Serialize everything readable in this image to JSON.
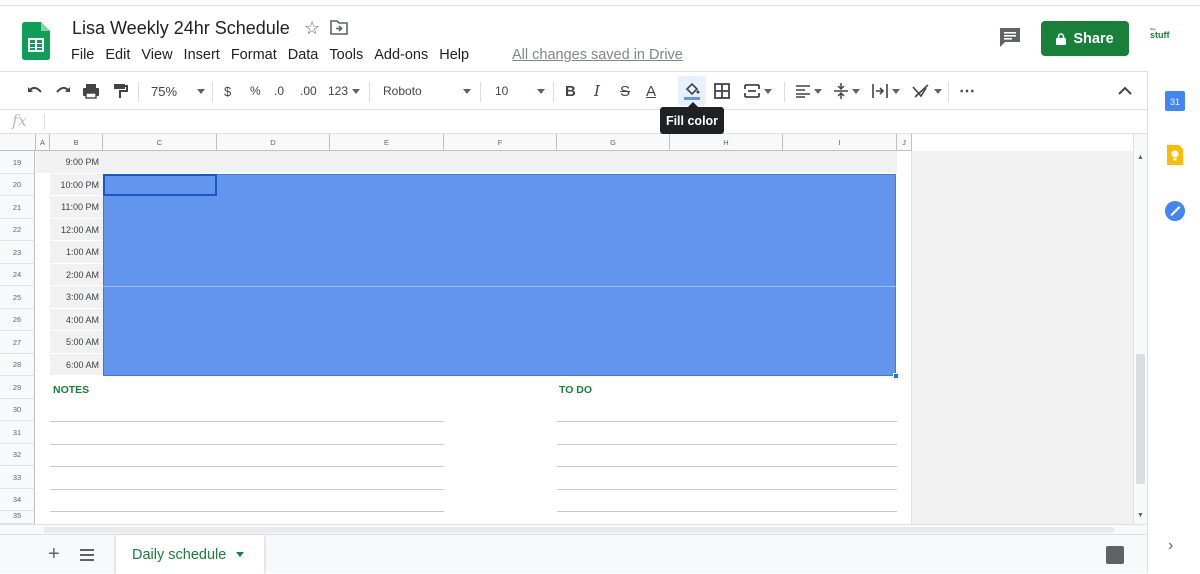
{
  "document": {
    "title": "Lisa Weekly 24hr Schedule",
    "save_status": "All changes saved in Drive"
  },
  "menu": [
    "File",
    "Edit",
    "View",
    "Insert",
    "Format",
    "Data",
    "Tools",
    "Add-ons",
    "Help"
  ],
  "header": {
    "share_label": "Share",
    "brand_text": "stuff"
  },
  "toolbar": {
    "zoom": "75%",
    "currency": "$",
    "percent": "%",
    "decrease_decimal": ".0",
    "increase_decimal": ".00",
    "more_formats": "123",
    "font": "Roboto",
    "font_size": "10",
    "bold": "B",
    "italic": "I",
    "strikethrough": "S",
    "text_color": "A",
    "more": "⋯",
    "tooltip": "Fill color"
  },
  "formula_bar": {
    "fx": "fx",
    "value": ""
  },
  "columns": [
    "A",
    "B",
    "C",
    "D",
    "E",
    "F",
    "G",
    "H",
    "I",
    "J"
  ],
  "rows": [
    {
      "num": "19",
      "time": "9:00 PM"
    },
    {
      "num": "20",
      "time": "10:00 PM"
    },
    {
      "num": "21",
      "time": "11:00 PM"
    },
    {
      "num": "22",
      "time": "12:00 AM"
    },
    {
      "num": "23",
      "time": "1:00 AM"
    },
    {
      "num": "24",
      "time": "2:00 AM"
    },
    {
      "num": "25",
      "time": "3:00 AM"
    },
    {
      "num": "26",
      "time": "4:00 AM"
    },
    {
      "num": "27",
      "time": "5:00 AM"
    },
    {
      "num": "28",
      "time": "6:00 AM"
    },
    {
      "num": "29",
      "time": ""
    },
    {
      "num": "30",
      "time": ""
    },
    {
      "num": "31",
      "time": ""
    },
    {
      "num": "32",
      "time": ""
    },
    {
      "num": "33",
      "time": ""
    },
    {
      "num": "34",
      "time": ""
    },
    {
      "num": "35",
      "time": ""
    }
  ],
  "sections": {
    "notes": "NOTES",
    "todo": "TO DO"
  },
  "sheet_tab": "Daily schedule",
  "calendar_day": "31",
  "colors": {
    "selection_fill": "#6495ed",
    "accent_green": "#188038",
    "tooltip_bg": "#202124"
  }
}
